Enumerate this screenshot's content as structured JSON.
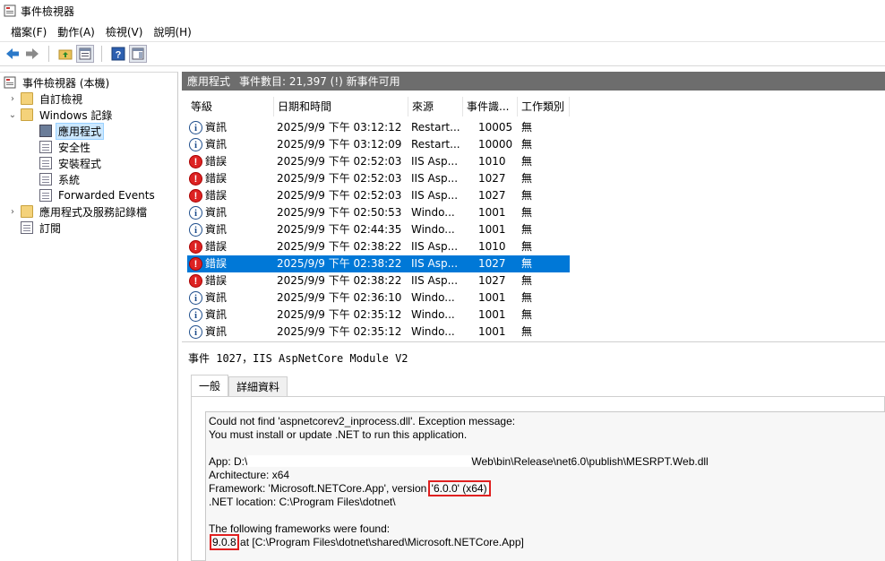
{
  "window": {
    "title": "事件檢視器"
  },
  "menu": [
    "檔案(F)",
    "動作(A)",
    "檢視(V)",
    "說明(H)"
  ],
  "toolbar": {
    "icons": [
      "back-arrow-icon",
      "forward-arrow-icon",
      "folder-up-icon",
      "properties-icon",
      "help-icon",
      "show-pane-icon"
    ]
  },
  "tree": {
    "root": "事件檢視器 (本機)",
    "custom_views": "自訂檢視",
    "windows_logs": "Windows 記錄",
    "application": "應用程式",
    "security": "安全性",
    "setup": "安裝程式",
    "system": "系統",
    "forwarded": "Forwarded Events",
    "apps_services": "應用程式及服務記錄檔",
    "subscriptions": "訂閱"
  },
  "header": {
    "log_name": "應用程式",
    "count_text": "事件數目: 21,397 (!) 新事件可用"
  },
  "columns": [
    "等級",
    "日期和時間",
    "來源",
    "事件識...",
    "工作類別"
  ],
  "events": [
    {
      "level": "資訊",
      "type": "info",
      "datetime": "2025/9/9 下午 03:12:12",
      "source": "Restart...",
      "id": "10005",
      "category": "無"
    },
    {
      "level": "資訊",
      "type": "info",
      "datetime": "2025/9/9 下午 03:12:09",
      "source": "Restart...",
      "id": "10000",
      "category": "無"
    },
    {
      "level": "錯誤",
      "type": "error",
      "datetime": "2025/9/9 下午 02:52:03",
      "source": "IIS Asp...",
      "id": "1010",
      "category": "無"
    },
    {
      "level": "錯誤",
      "type": "error",
      "datetime": "2025/9/9 下午 02:52:03",
      "source": "IIS Asp...",
      "id": "1027",
      "category": "無"
    },
    {
      "level": "錯誤",
      "type": "error",
      "datetime": "2025/9/9 下午 02:52:03",
      "source": "IIS Asp...",
      "id": "1027",
      "category": "無"
    },
    {
      "level": "資訊",
      "type": "info",
      "datetime": "2025/9/9 下午 02:50:53",
      "source": "Windo...",
      "id": "1001",
      "category": "無"
    },
    {
      "level": "資訊",
      "type": "info",
      "datetime": "2025/9/9 下午 02:44:35",
      "source": "Windo...",
      "id": "1001",
      "category": "無"
    },
    {
      "level": "錯誤",
      "type": "error",
      "datetime": "2025/9/9 下午 02:38:22",
      "source": "IIS Asp...",
      "id": "1010",
      "category": "無"
    },
    {
      "level": "錯誤",
      "type": "error",
      "datetime": "2025/9/9 下午 02:38:22",
      "source": "IIS Asp...",
      "id": "1027",
      "category": "無",
      "selected": true
    },
    {
      "level": "錯誤",
      "type": "error",
      "datetime": "2025/9/9 下午 02:38:22",
      "source": "IIS Asp...",
      "id": "1027",
      "category": "無"
    },
    {
      "level": "資訊",
      "type": "info",
      "datetime": "2025/9/9 下午 02:36:10",
      "source": "Windo...",
      "id": "1001",
      "category": "無"
    },
    {
      "level": "資訊",
      "type": "info",
      "datetime": "2025/9/9 下午 02:35:12",
      "source": "Windo...",
      "id": "1001",
      "category": "無"
    },
    {
      "level": "資訊",
      "type": "info",
      "datetime": "2025/9/9 下午 02:35:12",
      "source": "Windo...",
      "id": "1001",
      "category": "無"
    }
  ],
  "detail": {
    "title": "事件 1027，IIS AspNetCore Module V2",
    "tab_general": "一般",
    "tab_details": "詳細資料",
    "line1": "Could not find 'aspnetcorev2_inprocess.dll'. Exception message:",
    "line2": "You must install or update .NET to run this application.",
    "app_prefix": "App: D:\\",
    "app_suffix": "Web\\bin\\Release\\net6.0\\publish\\MESRPT.Web.dll",
    "architecture": "Architecture: x64",
    "framework_prefix": "Framework: 'Microsoft.NETCore.App', version ",
    "framework_version": "'6.0.0' (x64)",
    "net_location": ".NET location: C:\\Program Files\\dotnet\\",
    "found_header": "The following frameworks were found:",
    "found_version": "9.0.8",
    "found_suffix": " at [C:\\Program Files\\dotnet\\shared\\Microsoft.NETCore.App]"
  }
}
